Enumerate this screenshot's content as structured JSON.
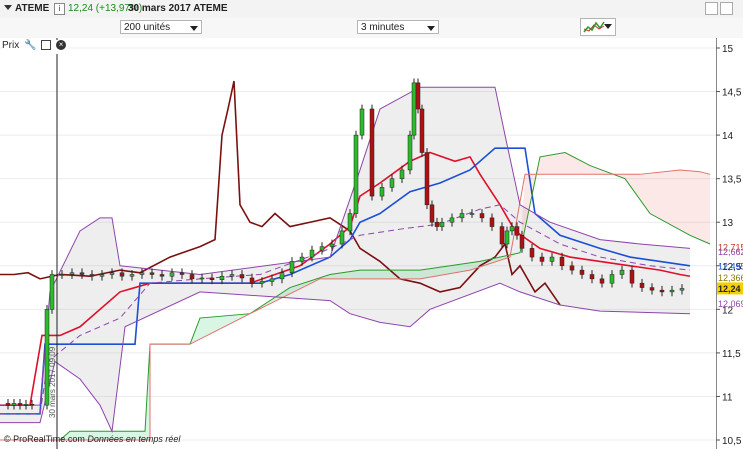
{
  "header": {
    "symbol": "ATEME",
    "price_change": "12,24 (+13,97%)",
    "date_symbol": "30 mars 2017 ATEME",
    "colors": {
      "positive": "#1a8c1a"
    }
  },
  "toolbar": {
    "units_select": "200 unités",
    "interval_select": "3 minutes",
    "indicator_icon": "ichimoku-indicator-icon"
  },
  "chart_panel": {
    "label": "Prix",
    "icons": [
      "wrench-icon",
      "maximize-icon",
      "close-icon"
    ]
  },
  "footer": {
    "copyright": "© ProRealTime.com",
    "realtime": "Données en temps réel",
    "date_marker": "30 mars 2017 09:09"
  },
  "chart_data": {
    "type": "line",
    "ylim": [
      10.5,
      15
    ],
    "y_ticks": [
      "15",
      "14,5",
      "14",
      "13,5",
      "13",
      "12,5",
      "12",
      "11,5",
      "11",
      "10,5"
    ],
    "price_tags": [
      {
        "label": "12,715",
        "value": 12.715,
        "color": "#c0392b"
      },
      {
        "label": "12,662",
        "value": 12.662,
        "color": "#8e44ad"
      },
      {
        "label": "12,495",
        "value": 12.495,
        "color": "#1a4fd6"
      },
      {
        "label": "12,366",
        "value": 12.366,
        "color": "#8a7a00"
      },
      {
        "label": "12,24",
        "value": 12.24,
        "color": "#222222",
        "bg": "#f5d000"
      },
      {
        "label": "12,069",
        "value": 12.069,
        "color": "#8e44ad"
      }
    ],
    "series": [
      {
        "values": [
          [
            0,
            12.4
          ],
          [
            14,
            12.4
          ],
          [
            28,
            12.42
          ],
          [
            40,
            12.35
          ],
          [
            60,
            12.4
          ],
          [
            90,
            12.38
          ],
          [
            120,
            12.45
          ],
          [
            140,
            12.42
          ],
          [
            170,
            12.6
          ],
          [
            200,
            12.72
          ],
          [
            215,
            12.8
          ],
          [
            222,
            14
          ],
          [
            228,
            14.3
          ],
          [
            234,
            14.62
          ],
          [
            240,
            13.2
          ],
          [
            250,
            13.0
          ],
          [
            262,
            12.95
          ],
          [
            275,
            13.1
          ],
          [
            290,
            12.95
          ],
          [
            310,
            13.0
          ],
          [
            330,
            13.05
          ],
          [
            350,
            12.9
          ],
          [
            360,
            12.7
          ],
          [
            380,
            12.55
          ],
          [
            400,
            12.35
          ],
          [
            420,
            12.3
          ],
          [
            440,
            12.2
          ],
          [
            460,
            12.25
          ],
          [
            480,
            12.5
          ],
          [
            495,
            12.6
          ],
          [
            505,
            12.75
          ],
          [
            512,
            12.4
          ],
          [
            520,
            12.5
          ],
          [
            535,
            12.2
          ],
          [
            545,
            12.3
          ],
          [
            560,
            12.05
          ]
        ],
        "color": "#7b1010"
      },
      {
        "values": [
          [
            0,
            10.9
          ],
          [
            30,
            10.9
          ],
          [
            42,
            11.7
          ],
          [
            60,
            11.7
          ],
          [
            80,
            11.8
          ],
          [
            120,
            12.2
          ],
          [
            150,
            12.3
          ],
          [
            180,
            12.3
          ],
          [
            250,
            12.3
          ],
          [
            300,
            12.5
          ],
          [
            330,
            12.75
          ],
          [
            350,
            12.95
          ],
          [
            360,
            13.3
          ],
          [
            380,
            13.45
          ],
          [
            410,
            13.7
          ],
          [
            430,
            13.8
          ],
          [
            455,
            13.7
          ],
          [
            470,
            13.75
          ],
          [
            480,
            13.55
          ],
          [
            500,
            13.2
          ],
          [
            515,
            12.9
          ],
          [
            540,
            12.7
          ],
          [
            570,
            12.6
          ],
          [
            600,
            12.55
          ],
          [
            630,
            12.5
          ],
          [
            660,
            12.45
          ],
          [
            680,
            12.4
          ],
          [
            690,
            12.38
          ]
        ],
        "color": "#e0102a"
      },
      {
        "values": [
          [
            0,
            10.8
          ],
          [
            40,
            10.8
          ],
          [
            45,
            11.6
          ],
          [
            90,
            11.6
          ],
          [
            135,
            11.6
          ],
          [
            140,
            12.3
          ],
          [
            200,
            12.3
          ],
          [
            260,
            12.3
          ],
          [
            290,
            12.4
          ],
          [
            330,
            12.6
          ],
          [
            350,
            12.8
          ],
          [
            360,
            13.0
          ],
          [
            380,
            13.1
          ],
          [
            410,
            13.35
          ],
          [
            440,
            13.45
          ],
          [
            470,
            13.6
          ],
          [
            495,
            13.85
          ],
          [
            525,
            13.85
          ],
          [
            535,
            13.1
          ],
          [
            560,
            12.85
          ],
          [
            600,
            12.7
          ],
          [
            630,
            12.6
          ],
          [
            660,
            12.55
          ],
          [
            690,
            12.5
          ]
        ],
        "color": "#1a4fd6"
      },
      {
        "values": [
          [
            0,
            10.8
          ],
          [
            40,
            10.8
          ],
          [
            48,
            11.4
          ],
          [
            80,
            11.7
          ],
          [
            120,
            11.9
          ],
          [
            150,
            12.3
          ],
          [
            200,
            12.35
          ],
          [
            260,
            12.4
          ],
          [
            320,
            12.65
          ],
          [
            360,
            12.85
          ],
          [
            400,
            12.92
          ],
          [
            440,
            12.98
          ],
          [
            480,
            13.15
          ],
          [
            500,
            13.2
          ],
          [
            520,
            13.0
          ],
          [
            560,
            12.75
          ],
          [
            600,
            12.6
          ],
          [
            650,
            12.5
          ],
          [
            690,
            12.45
          ]
        ],
        "color": "#8e44ad"
      },
      {
        "values": [
          [
            0,
            10.5
          ],
          [
            60,
            10.5
          ],
          [
            70,
            10.6
          ],
          [
            145,
            10.6
          ],
          [
            150,
            11.6
          ],
          [
            190,
            11.6
          ],
          [
            200,
            11.9
          ],
          [
            250,
            11.95
          ],
          [
            290,
            12.25
          ],
          [
            330,
            12.4
          ],
          [
            360,
            12.45
          ],
          [
            420,
            12.45
          ],
          [
            480,
            12.55
          ],
          [
            520,
            12.65
          ],
          [
            540,
            13.75
          ],
          [
            565,
            13.8
          ],
          [
            590,
            13.65
          ],
          [
            625,
            13.5
          ],
          [
            650,
            13.1
          ],
          [
            690,
            12.85
          ],
          [
            710,
            12.75
          ]
        ],
        "color": "#2a9a2a"
      },
      {
        "values": [
          [
            0,
            10.5
          ],
          [
            150,
            10.5
          ],
          [
            150,
            11.6
          ],
          [
            190,
            11.6
          ],
          [
            250,
            11.95
          ],
          [
            320,
            12.35
          ],
          [
            420,
            12.35
          ],
          [
            470,
            12.45
          ],
          [
            510,
            12.6
          ],
          [
            525,
            13.55
          ],
          [
            565,
            13.55
          ],
          [
            600,
            13.55
          ],
          [
            640,
            13.55
          ],
          [
            680,
            13.6
          ],
          [
            700,
            13.58
          ],
          [
            710,
            13.55
          ]
        ],
        "color": "#e0716d"
      },
      {
        "values": [
          [
            0,
            10.9
          ],
          [
            40,
            10.9
          ],
          [
            50,
            12.2
          ],
          [
            80,
            12.9
          ],
          [
            100,
            13.05
          ],
          [
            112,
            13.05
          ],
          [
            120,
            12.5
          ],
          [
            200,
            12.4
          ],
          [
            330,
            12.6
          ],
          [
            360,
            13.6
          ],
          [
            380,
            14.3
          ],
          [
            420,
            14.55
          ],
          [
            495,
            14.55
          ],
          [
            505,
            14.0
          ],
          [
            520,
            13.2
          ],
          [
            550,
            13.0
          ],
          [
            600,
            12.8
          ],
          [
            640,
            12.75
          ],
          [
            690,
            12.7
          ]
        ],
        "color": "#8e44ad"
      },
      {
        "values": [
          [
            0,
            10.7
          ],
          [
            40,
            10.7
          ],
          [
            55,
            11.4
          ],
          [
            80,
            11.2
          ],
          [
            100,
            10.9
          ],
          [
            112,
            10.6
          ],
          [
            125,
            11.8
          ],
          [
            200,
            12.2
          ],
          [
            330,
            12.1
          ],
          [
            350,
            11.95
          ],
          [
            380,
            11.85
          ],
          [
            410,
            11.8
          ],
          [
            430,
            12.0
          ],
          [
            500,
            12.3
          ],
          [
            520,
            12.2
          ],
          [
            560,
            12.05
          ],
          [
            600,
            11.98
          ],
          [
            690,
            11.95
          ]
        ],
        "color": "#8e44ad"
      }
    ],
    "grid": true,
    "cloud": "green/red filled between leading spans",
    "bollinger_fill": "light gray between bands"
  }
}
